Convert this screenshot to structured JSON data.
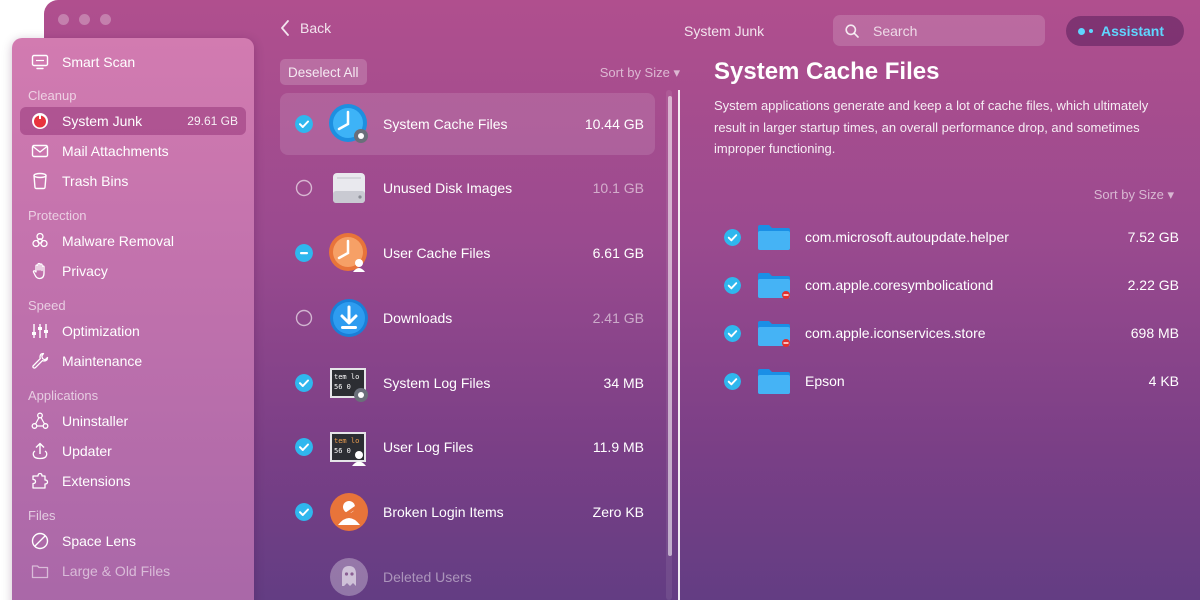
{
  "window": {
    "title": "System Junk"
  },
  "toolbar": {
    "back_label": "Back",
    "search_placeholder": "Search",
    "assistant_label": "Assistant"
  },
  "sidebar": {
    "items": [
      {
        "label": "Smart Scan",
        "icon": "monitor-icon"
      },
      {
        "section": "Cleanup"
      },
      {
        "label": "System Junk",
        "size": "29.61 GB",
        "icon": "system-junk-icon",
        "active": true
      },
      {
        "label": "Mail Attachments",
        "icon": "envelope-icon"
      },
      {
        "label": "Trash Bins",
        "icon": "trash-icon"
      },
      {
        "section": "Protection"
      },
      {
        "label": "Malware Removal",
        "icon": "biohazard-icon"
      },
      {
        "label": "Privacy",
        "icon": "hand-icon"
      },
      {
        "section": "Speed"
      },
      {
        "label": "Optimization",
        "icon": "sliders-icon"
      },
      {
        "label": "Maintenance",
        "icon": "wrench-icon"
      },
      {
        "section": "Applications"
      },
      {
        "label": "Uninstaller",
        "icon": "uninstaller-icon"
      },
      {
        "label": "Updater",
        "icon": "updater-icon"
      },
      {
        "label": "Extensions",
        "icon": "extensions-icon"
      },
      {
        "section": "Files"
      },
      {
        "label": "Space Lens",
        "icon": "space-lens-icon"
      },
      {
        "label": "Large & Old Files",
        "icon": "folder-icon"
      }
    ]
  },
  "list": {
    "deselect_label": "Deselect All",
    "sort_label": "Sort by Size ▾",
    "rows": [
      {
        "name": "System Cache Files",
        "size": "10.44 GB",
        "state": "checked",
        "icon": "system-cache-icon"
      },
      {
        "name": "Unused Disk Images",
        "size": "10.1 GB",
        "state": "unchecked",
        "icon": "disk-image-icon"
      },
      {
        "name": "User Cache Files",
        "size": "6.61 GB",
        "state": "partial",
        "icon": "user-cache-icon"
      },
      {
        "name": "Downloads",
        "size": "2.41 GB",
        "state": "unchecked",
        "icon": "downloads-icon"
      },
      {
        "name": "System Log Files",
        "size": "34 MB",
        "state": "checked",
        "icon": "system-log-icon"
      },
      {
        "name": "User Log Files",
        "size": "11.9 MB",
        "state": "checked",
        "icon": "user-log-icon"
      },
      {
        "name": "Broken Login Items",
        "size": "Zero KB",
        "state": "checked",
        "icon": "broken-login-icon"
      },
      {
        "name": "Deleted Users",
        "size": "",
        "state": "none",
        "icon": "deleted-users-icon"
      }
    ]
  },
  "detail": {
    "title": "System Cache Files",
    "description": "System applications generate and keep a lot of cache files, which ultimately result in larger startup times, an overall performance drop, and sometimes improper functioning.",
    "sort_label": "Sort by Size ▾",
    "files": [
      {
        "name": "com.microsoft.autoupdate.helper",
        "size": "7.52 GB",
        "badge": false
      },
      {
        "name": "com.apple.coresymbolicationd",
        "size": "2.22 GB",
        "badge": true
      },
      {
        "name": "com.apple.iconservices.store",
        "size": "698 MB",
        "badge": true
      },
      {
        "name": "Epson",
        "size": "4 KB",
        "badge": false
      }
    ]
  },
  "colors": {
    "accent": "#2fb7ee",
    "assistant": "#5fd6ff",
    "orange": "#f08b45"
  }
}
